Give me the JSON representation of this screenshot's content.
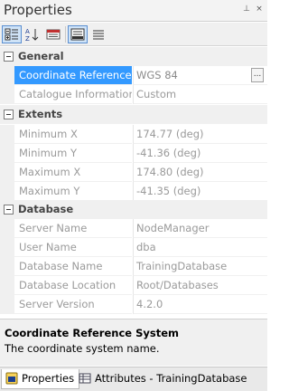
{
  "window": {
    "title": "Properties",
    "pin_glyph": "⊥",
    "close_glyph": "×"
  },
  "toolbar": {
    "buttons": [
      {
        "name": "categorized-icon",
        "active": true
      },
      {
        "name": "alphabetical-icon",
        "active": false
      },
      {
        "name": "property-pages-icon",
        "active": false
      },
      {
        "name": "show-description-icon",
        "active": true
      },
      {
        "name": "list-view-icon",
        "active": false
      }
    ]
  },
  "grid": {
    "categories": [
      {
        "label": "General"
      },
      {
        "label": "Extents"
      },
      {
        "label": "Database"
      }
    ],
    "general": [
      {
        "name": "Coordinate Reference S",
        "value": "WGS 84"
      },
      {
        "name": "Catalogue Information",
        "value": "Custom"
      }
    ],
    "extents": [
      {
        "name": "Minimum X",
        "value": "174.77 (deg)"
      },
      {
        "name": "Minimum Y",
        "value": "-41.36 (deg)"
      },
      {
        "name": "Maximum X",
        "value": "174.80 (deg)"
      },
      {
        "name": "Maximum Y",
        "value": "-41.35 (deg)"
      }
    ],
    "database": [
      {
        "name": "Server Name",
        "value": "NodeManager"
      },
      {
        "name": "User Name",
        "value": "dba"
      },
      {
        "name": "Database Name",
        "value": "TrainingDatabase"
      },
      {
        "name": "Database Location",
        "value": "Root/Databases"
      },
      {
        "name": "Server Version",
        "value": "4.2.0"
      }
    ],
    "ellipsis_label": "..."
  },
  "description": {
    "title": "Coordinate Reference System",
    "text": "The coordinate system name."
  },
  "tabs": [
    {
      "label": "Properties",
      "active": true
    },
    {
      "label": "Attributes - TrainingDatabase",
      "active": false
    }
  ]
}
